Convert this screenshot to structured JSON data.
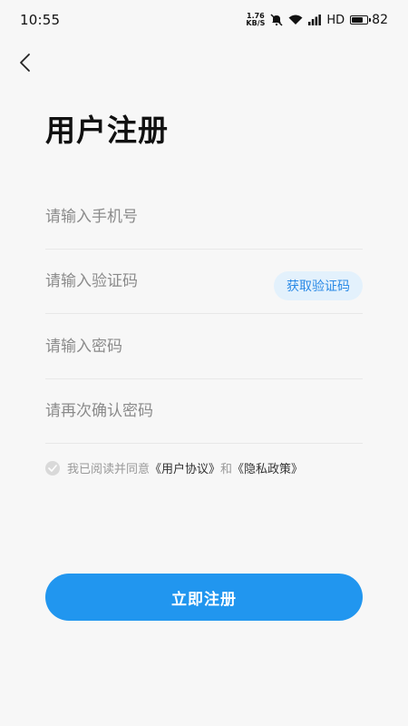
{
  "status_bar": {
    "time": "10:55",
    "net_speed_value": "1.76",
    "net_speed_unit": "KB/S",
    "network_type": "HD",
    "battery_level": "82",
    "battery_fraction": 0.82
  },
  "header": {
    "back_icon": "chevron-left-icon",
    "title": "用户注册"
  },
  "form": {
    "phone": {
      "placeholder": "请输入手机号",
      "value": ""
    },
    "code": {
      "placeholder": "请输入验证码",
      "value": "",
      "button_label": "获取验证码"
    },
    "password": {
      "placeholder": "请输入密码",
      "value": ""
    },
    "confirm_password": {
      "placeholder": "请再次确认密码",
      "value": ""
    }
  },
  "agreement": {
    "checked": false,
    "prefix": "我已阅读并同意",
    "user_agreement": "《用户协议》",
    "conjunction": "和",
    "privacy_policy": "《隐私政策》"
  },
  "submit": {
    "label": "立即注册"
  },
  "colors": {
    "primary": "#2196ef",
    "code_button_bg": "#e3f1fc",
    "code_button_text": "#2b8ae6",
    "background": "#f7f7f7"
  }
}
